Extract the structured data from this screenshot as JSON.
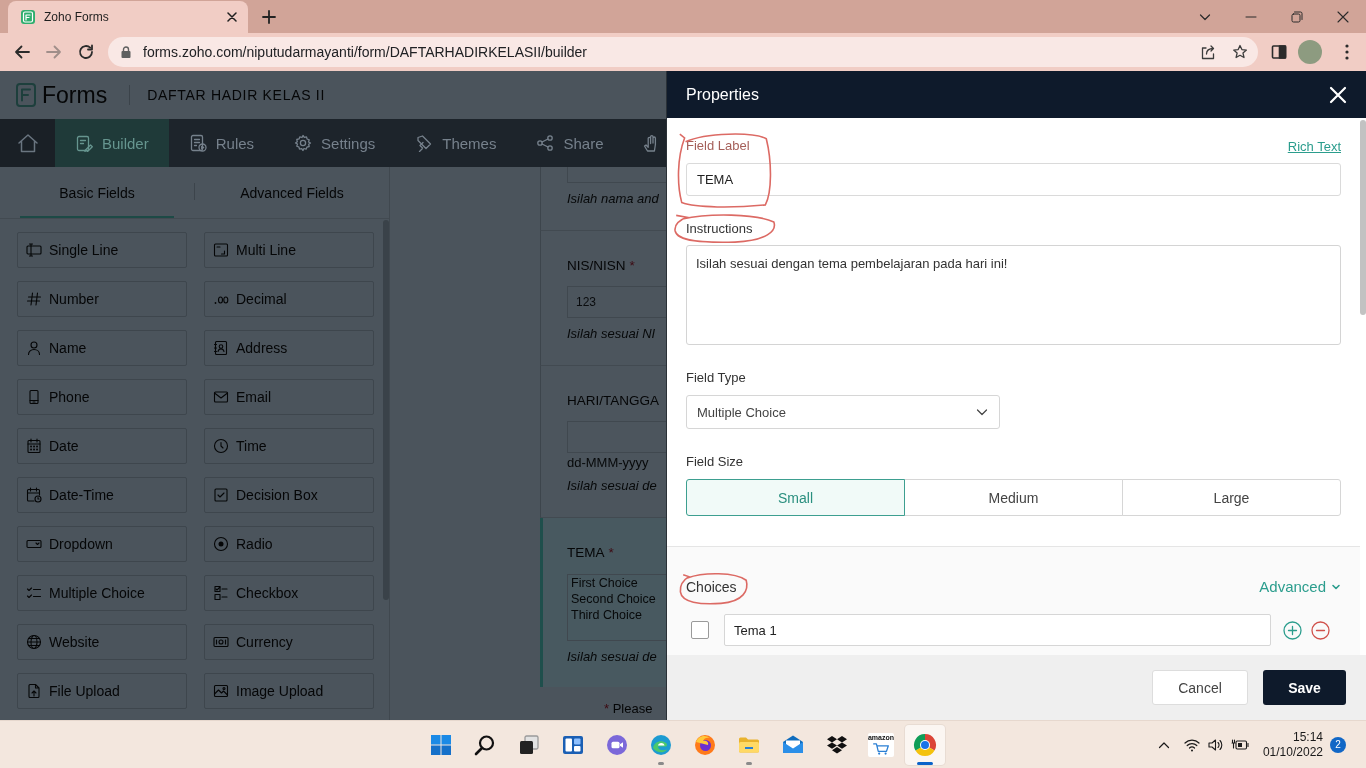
{
  "browser": {
    "tab_title": "Zoho Forms",
    "url": "forms.zoho.com/niputudarmayanti/form/DAFTARHADIRKELASII/builder"
  },
  "app_header": {
    "brand": "Forms",
    "form_title": "DAFTAR HADIR KELAS II"
  },
  "nav": [
    {
      "label": "Builder",
      "selected": true
    },
    {
      "label": "Rules",
      "selected": false
    },
    {
      "label": "Settings",
      "selected": false
    },
    {
      "label": "Themes",
      "selected": false
    },
    {
      "label": "Share",
      "selected": false
    }
  ],
  "field_panel": {
    "tabs": [
      {
        "label": "Basic Fields",
        "selected": true
      },
      {
        "label": "Advanced Fields",
        "selected": false
      }
    ],
    "fields": [
      "Single Line",
      "Multi Line",
      "Number",
      "Decimal",
      "Name",
      "Address",
      "Phone",
      "Email",
      "Date",
      "Time",
      "Date-Time",
      "Decision Box",
      "Dropdown",
      "Radio",
      "Multiple Choice",
      "Checkbox",
      "Website",
      "Currency",
      "File Upload",
      "Image Upload"
    ]
  },
  "form_preview": {
    "fields": [
      {
        "kind": "text",
        "instructions": "Isilah nama and",
        "selected": false
      },
      {
        "kind": "number",
        "label": "NIS/NISN",
        "required_mark": "*",
        "placeholder": "123",
        "instructions": "Isilah sesuai NI",
        "selected": false
      },
      {
        "kind": "date",
        "label": "HARI/TANGGA",
        "hint": "dd-MMM-yyyy",
        "instructions": "Isilah sesuai de",
        "selected": false
      },
      {
        "kind": "choices",
        "label": "TEMA",
        "required_mark": "*",
        "choices": [
          "First Choice",
          "Second Choice",
          "Third Choice"
        ],
        "instructions": "Isilah sesuai de",
        "selected": true
      }
    ],
    "footnote": {
      "mark": "*",
      "text": "Please"
    }
  },
  "properties": {
    "title": "Properties",
    "field_label": {
      "label": "Field Label",
      "value": "TEMA",
      "circled": true
    },
    "rich_text_link": "Rich Text",
    "instructions": {
      "label": "Instructions",
      "value": "Isilah sesuai dengan tema pembelajaran pada hari ini!",
      "circled": true
    },
    "field_type": {
      "label": "Field Type",
      "value": "Multiple Choice"
    },
    "field_size": {
      "label": "Field Size",
      "options": [
        {
          "label": "Small",
          "selected": true
        },
        {
          "label": "Medium",
          "selected": false
        },
        {
          "label": "Large",
          "selected": false
        }
      ]
    },
    "choices": {
      "label": "Choices",
      "circled": true,
      "advanced_link": "Advanced",
      "items": [
        {
          "value": "Tema 1",
          "checked": false
        }
      ]
    },
    "buttons": [
      {
        "label": "Cancel",
        "kind": "secondary"
      },
      {
        "label": "Save",
        "kind": "primary"
      }
    ]
  },
  "taskbar": {
    "apps": [
      {
        "running": false,
        "active": false
      },
      {
        "running": false,
        "active": false
      },
      {
        "running": false,
        "active": false
      },
      {
        "running": false,
        "active": false
      },
      {
        "running": false,
        "active": false
      },
      {
        "running": true,
        "active": false
      },
      {
        "running": false,
        "active": false
      },
      {
        "running": true,
        "active": false
      },
      {
        "running": false,
        "active": false
      },
      {
        "running": false,
        "active": false
      },
      {
        "running": false,
        "active": false,
        "logo_text": "amazon"
      },
      {
        "running": true,
        "active": true
      }
    ],
    "time": "15:14",
    "date": "01/10/2022",
    "notifications": "2"
  }
}
